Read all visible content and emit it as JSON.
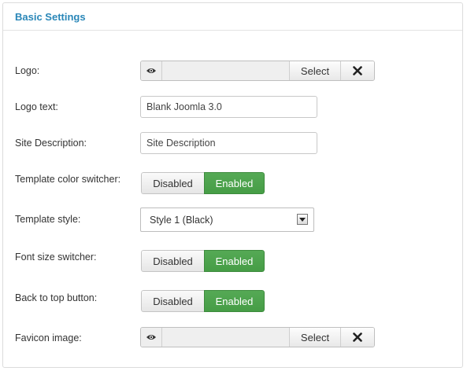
{
  "panel": {
    "title": "Basic Settings"
  },
  "logo": {
    "label": "Logo:",
    "select_label": "Select"
  },
  "logo_text": {
    "label": "Logo text:",
    "value": "Blank Joomla 3.0"
  },
  "site_description": {
    "label": "Site Description:",
    "placeholder": "Site Description"
  },
  "template_color_switcher": {
    "label": "Template color switcher:",
    "off_label": "Disabled",
    "on_label": "Enabled",
    "selected": "Enabled"
  },
  "template_style": {
    "label": "Template style:",
    "selected": "Style 1 (Black)"
  },
  "font_size_switcher": {
    "label": "Font size switcher:",
    "off_label": "Disabled",
    "on_label": "Enabled",
    "selected": "Enabled"
  },
  "back_to_top": {
    "label": "Back to top button:",
    "off_label": "Disabled",
    "on_label": "Enabled",
    "selected": "Enabled"
  },
  "favicon": {
    "label": "Favicon image:",
    "select_label": "Select"
  },
  "colors": {
    "title": "#2a87b8",
    "enabled_bg": "#4da64d",
    "border": "#dcdcdc"
  },
  "icons": {
    "preview": "eye-icon",
    "clear": "close-icon",
    "dropdown": "triangle-down-icon"
  }
}
